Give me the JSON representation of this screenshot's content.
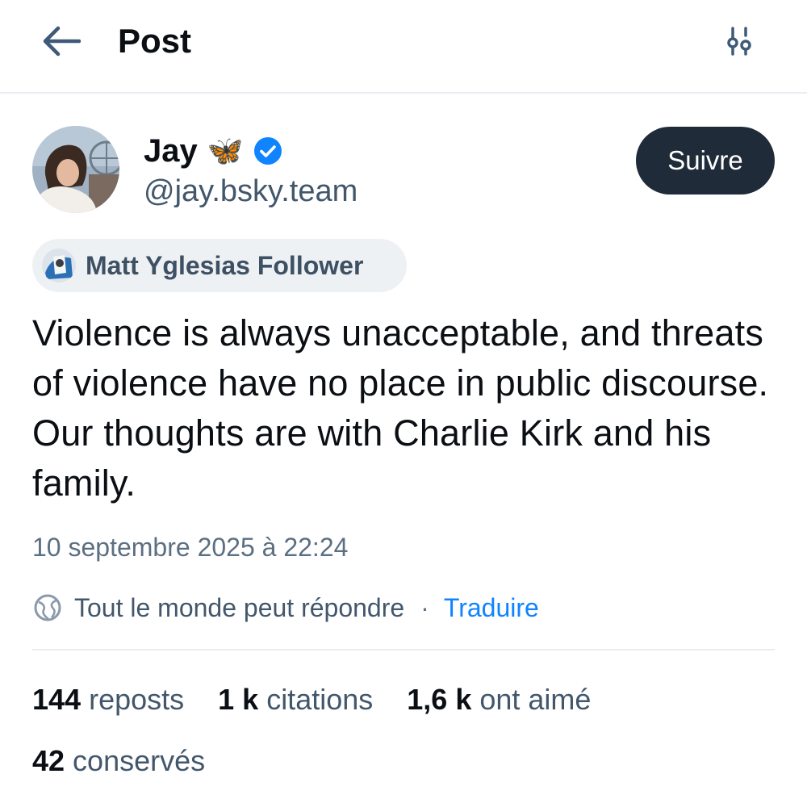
{
  "header": {
    "back_icon": "arrow-left-icon",
    "title": "Post",
    "settings_icon": "sliders-icon"
  },
  "author": {
    "avatar_icon": "user-avatar",
    "name": "Jay",
    "emoji": "🦋",
    "verified_icon": "verified-badge-icon",
    "handle": "@jay.bsky.team",
    "follow_label": "Suivre"
  },
  "label": {
    "icon": "labeler-avatar",
    "text": "Matt Yglesias Follower"
  },
  "post": {
    "text": "Violence is always unacceptable, and threats of violence have no place in public discourse. Our thoughts are with Charlie Kirk and his family.",
    "timestamp": "10 septembre 2025 à 22:24"
  },
  "reply": {
    "icon": "globe-icon",
    "text": "Tout le monde peut répondre",
    "separator": "·",
    "translate": "Traduire"
  },
  "stats": [
    {
      "count": "144",
      "label": "reposts"
    },
    {
      "count": "1 k",
      "label": "citations"
    },
    {
      "count": "1,6 k",
      "label": "ont aimé"
    },
    {
      "count": "42",
      "label": "conservés"
    }
  ],
  "colors": {
    "primary_text": "#0b0f14",
    "secondary_text": "#42576c",
    "link": "#1083fe",
    "follow_bg": "#1f2b38",
    "pill_bg": "#eef1f4",
    "verified": "#1083fe"
  }
}
